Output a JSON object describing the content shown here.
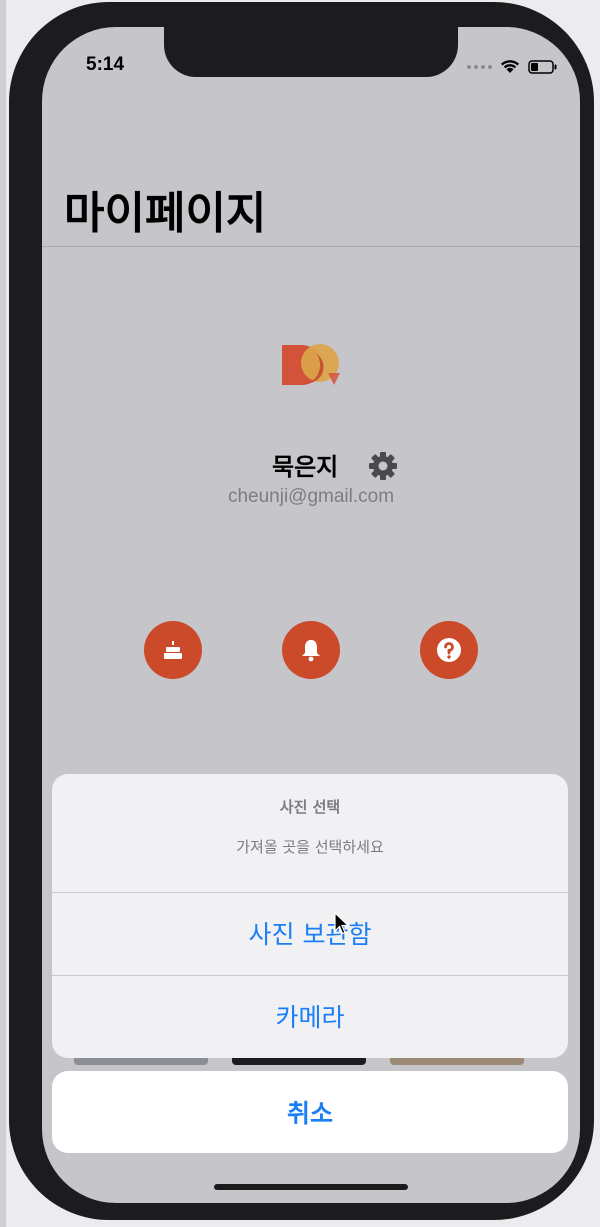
{
  "status_bar": {
    "time": "5:14"
  },
  "nav": {
    "title": "마이페이지"
  },
  "profile": {
    "name": "묵은지",
    "email": "cheunji@gmail.com"
  },
  "quick_actions": [
    {
      "icon": "birthday-cake-icon"
    },
    {
      "icon": "bell-icon"
    },
    {
      "icon": "question-icon"
    }
  ],
  "action_sheet": {
    "title": "사진 선택",
    "message": "가져올 곳을 선택하세요",
    "options": [
      "사진 보관함",
      "카메라"
    ],
    "cancel": "취소"
  },
  "colors": {
    "accent": "#1a7ef7",
    "brand": "#cb4a2a"
  }
}
